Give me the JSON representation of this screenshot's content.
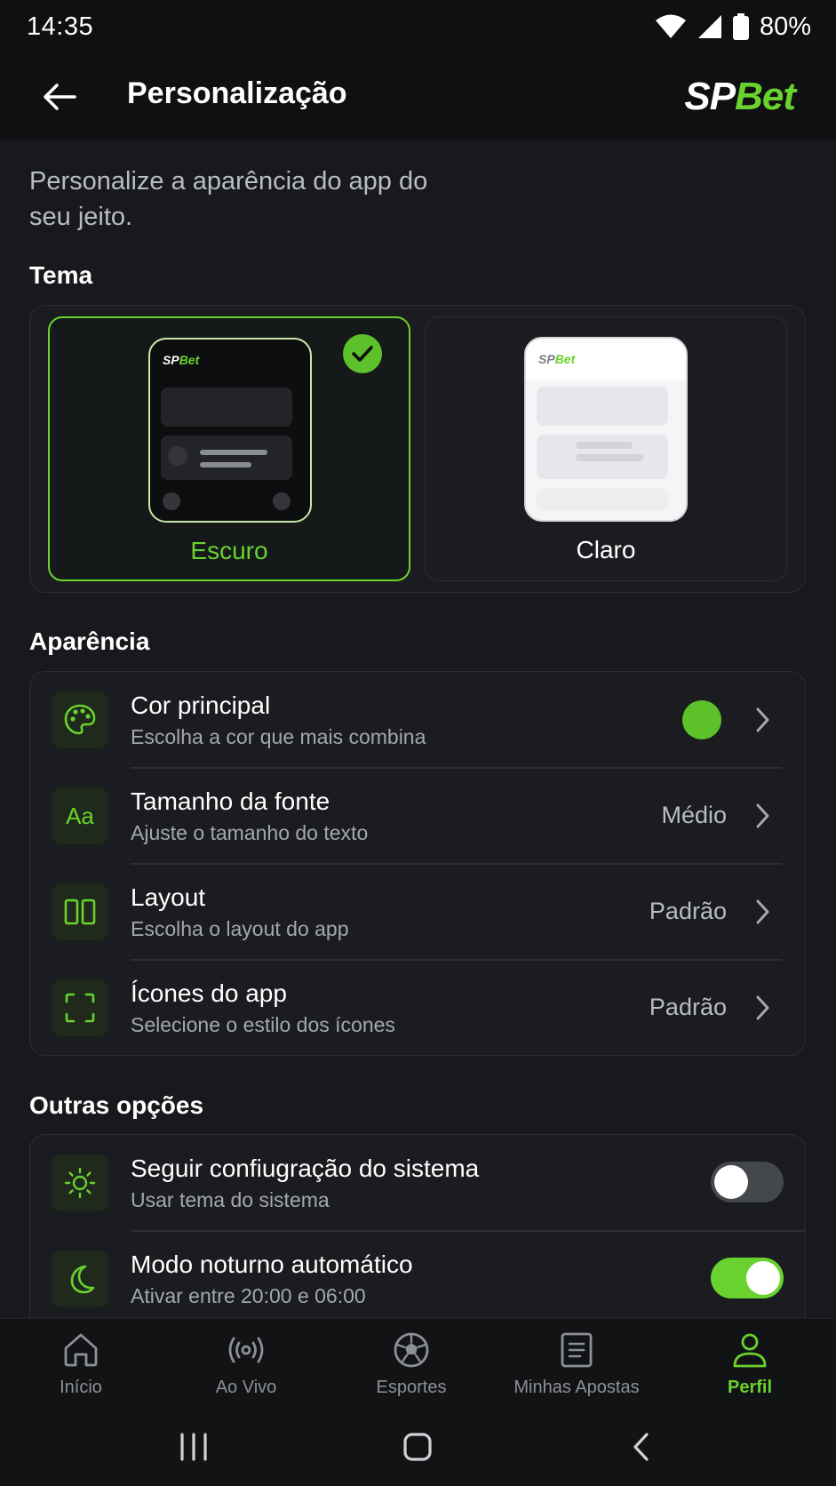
{
  "status_bar": {
    "time": "14:35",
    "battery": "80%"
  },
  "header": {
    "title": "Personalização",
    "logo_sp": "SP",
    "logo_bet": "Bet"
  },
  "intro": "Personalize a aparência do app do seu jeito.",
  "sections": {
    "theme": "Tema",
    "appearance": "Aparência",
    "other": "Outras opções"
  },
  "themes": [
    {
      "label": "Escuro",
      "selected": true
    },
    {
      "label": "Claro",
      "selected": false
    }
  ],
  "preview_logo": {
    "sp": "SP",
    "bet": "Bet"
  },
  "appearance": [
    {
      "title": "Cor principal",
      "subtitle": "Escolha a cor que mais combina",
      "value": "",
      "icon": "palette-icon",
      "color": "#5cc12a"
    },
    {
      "title": "Tamanho da fonte",
      "subtitle": "Ajuste o tamanho do texto",
      "value": "Médio",
      "icon": "font-size-icon"
    },
    {
      "title": "Layout",
      "subtitle": "Escolha o layout do app",
      "value": "Padrão",
      "icon": "layout-columns-icon"
    },
    {
      "title": "Ícones do app",
      "subtitle": "Selecione o estilo dos ícones",
      "value": "Padrão",
      "icon": "frame-corners-icon"
    }
  ],
  "font_icon_text": "Aa",
  "other": [
    {
      "title": "Seguir confiugração do sistema",
      "subtitle": "Usar tema do sistema",
      "toggle": false,
      "icon": "sun-icon"
    },
    {
      "title": "Modo noturno automático",
      "subtitle": "Ativar entre 20:00 e 06:00",
      "toggle": true,
      "icon": "moon-icon"
    }
  ],
  "nav": [
    {
      "label": "Início",
      "icon": "home-icon",
      "active": false
    },
    {
      "label": "Ao Vivo",
      "icon": "live-icon",
      "active": false
    },
    {
      "label": "Esportes",
      "icon": "soccer-ball-icon",
      "active": false
    },
    {
      "label": "Minhas Apostas",
      "icon": "bets-ticket-icon",
      "active": false
    },
    {
      "label": "Perfil",
      "icon": "profile-icon",
      "active": true
    }
  ],
  "colors": {
    "accent": "#6ad22e",
    "background": "#17191c",
    "card": "#1a1c1f"
  }
}
